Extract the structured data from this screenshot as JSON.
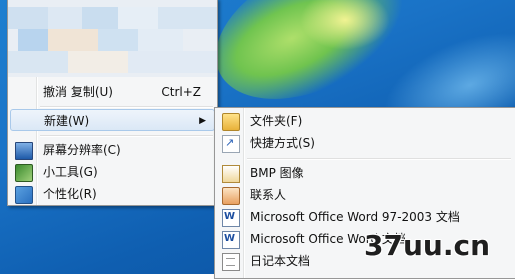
{
  "main_menu": {
    "undo_copy": {
      "label": "撤消 复制(U)",
      "shortcut": "Ctrl+Z"
    },
    "new": {
      "label": "新建(W)"
    },
    "screen_resolution": {
      "label": "屏幕分辨率(C)",
      "icon": "monitor-icon"
    },
    "gadgets": {
      "label": "小工具(G)",
      "icon": "gadget-icon"
    },
    "personalize": {
      "label": "个性化(R)",
      "icon": "personalize-icon"
    }
  },
  "new_submenu": {
    "items": [
      {
        "label": "文件夹(F)",
        "icon": "folder-icon"
      },
      {
        "label": "快捷方式(S)",
        "icon": "shortcut-icon"
      },
      {
        "label": "BMP 图像",
        "icon": "bmp-image-icon"
      },
      {
        "label": "联系人",
        "icon": "contact-icon"
      },
      {
        "label": "Microsoft Office Word 97-2003 文档",
        "icon": "word-doc-icon"
      },
      {
        "label": "Microsoft Office Word 文档",
        "icon": "word-docx-icon"
      },
      {
        "label": "日记本文档",
        "icon": "journal-doc-icon"
      }
    ]
  },
  "watermark": {
    "text": "37uu.cn"
  },
  "colors": {
    "menu_bg": "#f5f6f7",
    "highlight_border": "#a9c9ea",
    "desktop_blue": "#1a73c7"
  }
}
